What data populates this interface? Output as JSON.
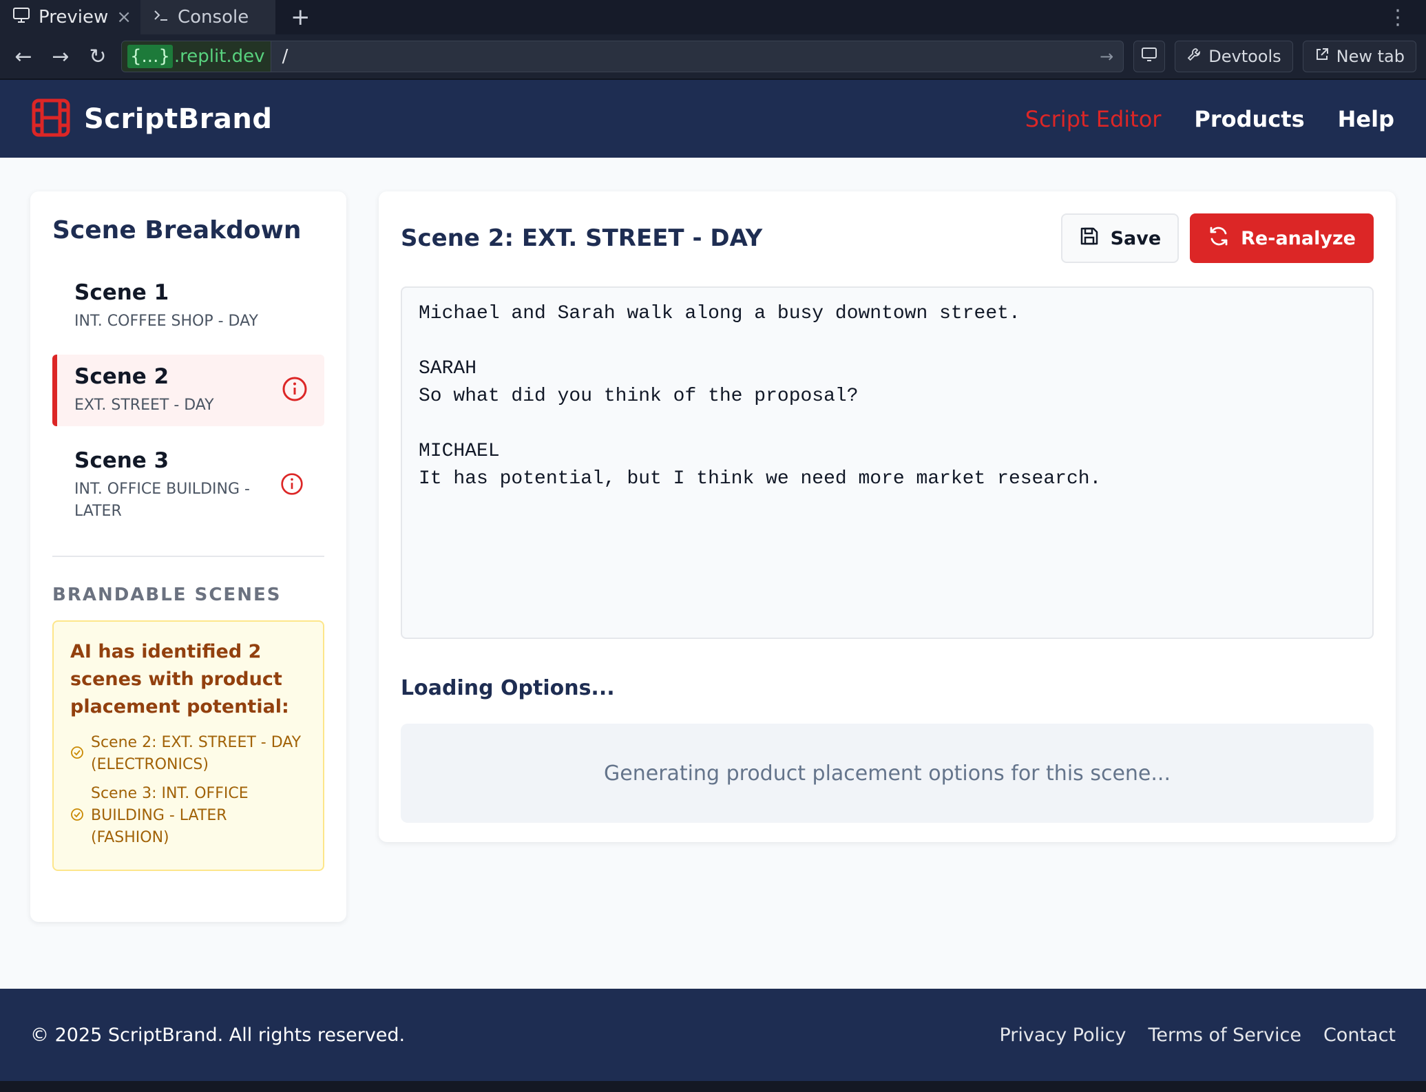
{
  "browser": {
    "tabs": [
      {
        "label": "Preview",
        "icon": "monitor-icon",
        "active": true
      },
      {
        "label": "Console",
        "icon": "terminal-icon",
        "active": false
      }
    ],
    "url_host_braces": "{...}",
    "url_host_domain": ".replit.dev",
    "url_path": "/",
    "devtools_label": "Devtools",
    "newtab_label": "New tab"
  },
  "header": {
    "brand": "ScriptBrand",
    "nav": {
      "script_editor": "Script Editor",
      "products": "Products",
      "help": "Help"
    }
  },
  "sidebar": {
    "title": "Scene Breakdown",
    "scenes": [
      {
        "title": "Scene 1",
        "location": "INT. COFFEE SHOP - DAY",
        "active": false,
        "flagged": false
      },
      {
        "title": "Scene 2",
        "location": "EXT. STREET - DAY",
        "active": true,
        "flagged": true
      },
      {
        "title": "Scene 3",
        "location": "INT. OFFICE BUILDING - LATER",
        "active": false,
        "flagged": true
      }
    ],
    "brandable_heading": "BRANDABLE SCENES",
    "brandable_message": "AI has identified 2 scenes with product placement potential:",
    "brandable_items": [
      "Scene 2: EXT. STREET - DAY (ELECTRONICS)",
      "Scene 3: INT. OFFICE BUILDING - LATER (FASHION)"
    ]
  },
  "main": {
    "title": "Scene 2: EXT. STREET - DAY",
    "save_label": "Save",
    "reanalyze_label": "Re-analyze",
    "script_text": "Michael and Sarah walk along a busy downtown street.\n\nSARAH\nSo what did you think of the proposal?\n\nMICHAEL\nIt has potential, but I think we need more market research.",
    "loading_title": "Loading Options...",
    "loading_message": "Generating product placement options for this scene..."
  },
  "footer": {
    "copyright": "© 2025 ScriptBrand. All rights reserved.",
    "links": {
      "privacy": "Privacy Policy",
      "terms": "Terms of Service",
      "contact": "Contact"
    }
  },
  "colors": {
    "brand_navy": "#1e2d52",
    "accent_red": "#dc2626",
    "highlight_yellow": "#fefce8"
  }
}
